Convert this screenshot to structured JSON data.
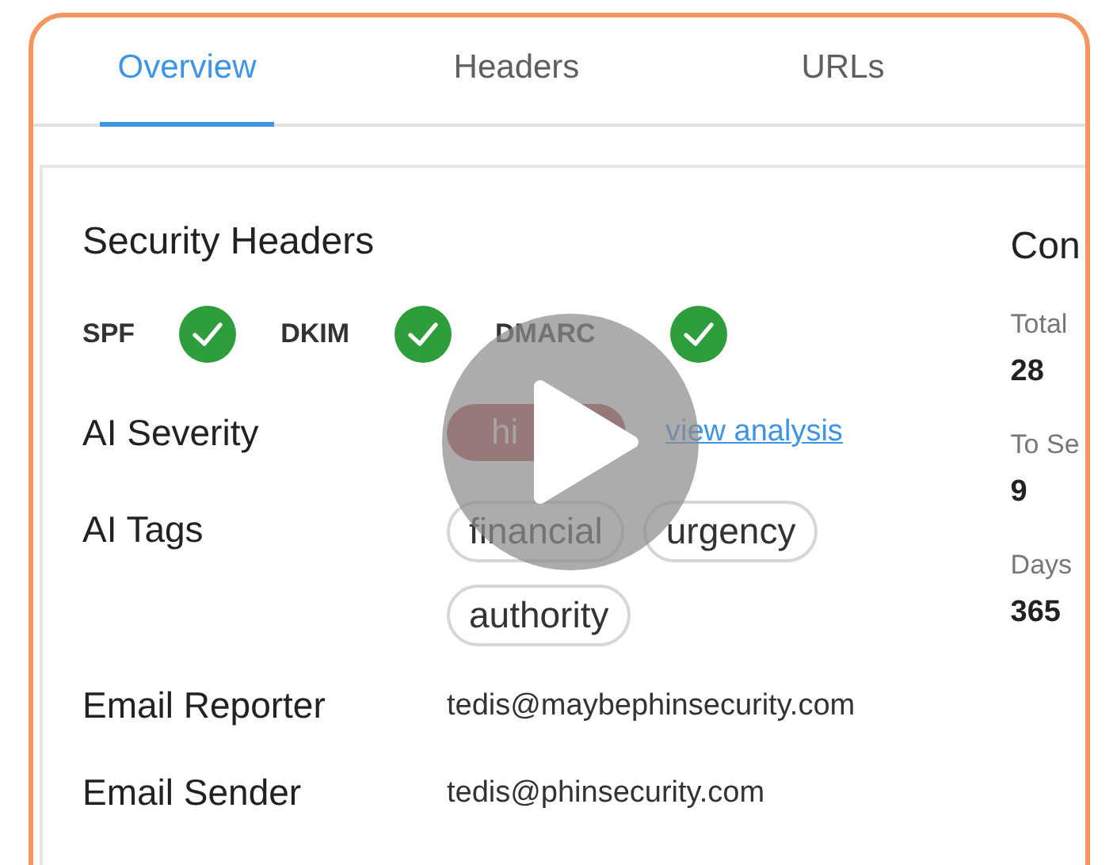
{
  "tabs": [
    {
      "label": "Overview",
      "selected": true
    },
    {
      "label": "Headers",
      "selected": false
    },
    {
      "label": "URLs",
      "selected": false
    }
  ],
  "security": {
    "title": "Security Headers",
    "checks": [
      {
        "label": "SPF",
        "passed": true
      },
      {
        "label": "DKIM",
        "passed": true
      },
      {
        "label": "DMARC",
        "passed": true
      }
    ],
    "severity": {
      "label": "AI Severity",
      "value": "hi",
      "link": "view analysis"
    },
    "tags": {
      "label": "AI Tags",
      "items": [
        "financial",
        "urgency",
        "authority"
      ]
    },
    "fields": [
      {
        "label": "Email Reporter",
        "value": "tedis@maybephinsecurity.com"
      },
      {
        "label": "Email Sender",
        "value": "tedis@phinsecurity.com"
      }
    ]
  },
  "side": {
    "title": "Con",
    "stats": [
      {
        "label": "Total",
        "value": "28"
      },
      {
        "label": "To Se",
        "value": "9"
      },
      {
        "label": "Days",
        "value": "365"
      }
    ]
  }
}
